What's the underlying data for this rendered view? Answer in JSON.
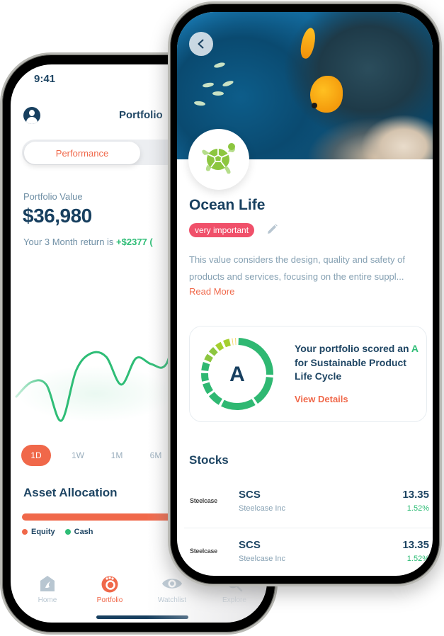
{
  "back_phone": {
    "status_time": "9:41",
    "header_title": "Portfolio",
    "segment": {
      "active_label": "Performance"
    },
    "portfolio_value": {
      "label": "Portfolio Value",
      "value": "$36,980",
      "return_prefix": "Your 3 Month return is ",
      "return_amount": "+$2377 ("
    },
    "performance_chart": {
      "type": "line",
      "series_color": "#2ebd76",
      "values": [
        0.3,
        0.42,
        0.4,
        0.1,
        0.52,
        0.66,
        0.63,
        0.4,
        0.62,
        0.57,
        0.57,
        0.95,
        0.74,
        0.68,
        0.82,
        0.78,
        0.8,
        0.76
      ]
    },
    "time_ranges": [
      "1D",
      "1W",
      "1M",
      "6M"
    ],
    "active_range": "1D",
    "asset_allocation": {
      "title": "Asset Allocation",
      "legend": [
        {
          "label": "Equity",
          "color": "#f0684a"
        },
        {
          "label": "Cash",
          "color": "#2ebd76"
        }
      ]
    },
    "tabbar": [
      {
        "label": "Home",
        "icon": "home-icon",
        "active": false
      },
      {
        "label": "Portfolio",
        "icon": "portfolio-icon",
        "active": true
      },
      {
        "label": "Watchlist",
        "icon": "eye-icon",
        "active": false
      },
      {
        "label": "Explore",
        "icon": "search-icon",
        "active": false
      }
    ]
  },
  "front_phone": {
    "back_button": "chevron-left-icon",
    "value_icon": "turtle-icon",
    "title": "Ocean Life",
    "importance_badge": "very important",
    "description": "This value considers the design, quality and safety of products and services, focusing on the entire suppl...",
    "read_more": "Read More",
    "score_card": {
      "grade": "A",
      "text_before": "Your portfolio scored an ",
      "text_after": " for Sustainable Product Life Cycle",
      "link": "View Details",
      "ring_segments": [
        {
          "fraction": 0.26,
          "color": "#2fb872"
        },
        {
          "fraction": 0.15,
          "color": "#2fb872"
        },
        {
          "fraction": 0.17,
          "color": "#2fb872"
        },
        {
          "fraction": 0.07,
          "color": "#2fb872"
        },
        {
          "fraction": 0.06,
          "color": "#2fb872"
        },
        {
          "fraction": 0.05,
          "color": "#2fb872"
        },
        {
          "fraction": 0.05,
          "color": "#2fb872"
        },
        {
          "fraction": 0.04,
          "color": "#8cc63f"
        },
        {
          "fraction": 0.04,
          "color": "#8cc63f"
        },
        {
          "fraction": 0.04,
          "color": "#a5cf2f"
        },
        {
          "fraction": 0.04,
          "color": "#a5cf2f"
        },
        {
          "fraction": 0.015,
          "color": "#f3d35b"
        },
        {
          "fraction": 0.015,
          "color": "#f3d35b"
        }
      ]
    },
    "stocks": {
      "title": "Stocks",
      "rows": [
        {
          "logo": "Steelcase",
          "ticker": "SCS",
          "name": "Steelcase Inc",
          "price": "13.35",
          "change": "1.52%"
        },
        {
          "logo": "Steelcase",
          "ticker": "SCS",
          "name": "Steelcase Inc",
          "price": "13.35",
          "change": "1.52%"
        }
      ]
    }
  }
}
